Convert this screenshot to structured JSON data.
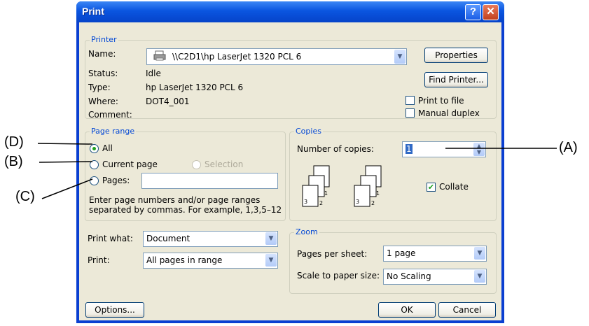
{
  "window": {
    "title": "Print"
  },
  "printer": {
    "legend": "Printer",
    "name_label": "Name:",
    "name_value": "\\\\C2D1\\hp LaserJet 1320 PCL 6",
    "properties_button": "Properties",
    "status_label": "Status:",
    "status_value": "Idle",
    "type_label": "Type:",
    "type_value": "hp LaserJet 1320 PCL 6",
    "where_label": "Where:",
    "where_value": "DOT4_001",
    "comment_label": "Comment:",
    "find_printer_button": "Find Printer...",
    "print_to_file": "Print to file",
    "manual_duplex": "Manual duplex"
  },
  "page_range": {
    "legend": "Page range",
    "all": "All",
    "current_page": "Current page",
    "selection": "Selection",
    "pages": "Pages:",
    "help_line1": "Enter page numbers and/or page ranges",
    "help_line2": "separated by commas.  For example, 1,3,5–12"
  },
  "copies": {
    "legend": "Copies",
    "number_label": "Number of copies:",
    "number_value": "1",
    "collate": "Collate",
    "collate_checked": true
  },
  "print_what": {
    "label": "Print what:",
    "value": "Document"
  },
  "print": {
    "label": "Print:",
    "value": "All pages in range"
  },
  "zoom": {
    "legend": "Zoom",
    "pages_per_sheet_label": "Pages per sheet:",
    "pages_per_sheet_value": "1 page",
    "scale_label": "Scale to paper size:",
    "scale_value": "No Scaling"
  },
  "buttons": {
    "options": "Options...",
    "ok": "OK",
    "cancel": "Cancel"
  },
  "annotations": {
    "a": "(A)",
    "b": "(B)",
    "c": "(C)",
    "d": "(D)"
  },
  "collate_pages": [
    "1",
    "2",
    "3",
    "1",
    "2",
    "3"
  ]
}
